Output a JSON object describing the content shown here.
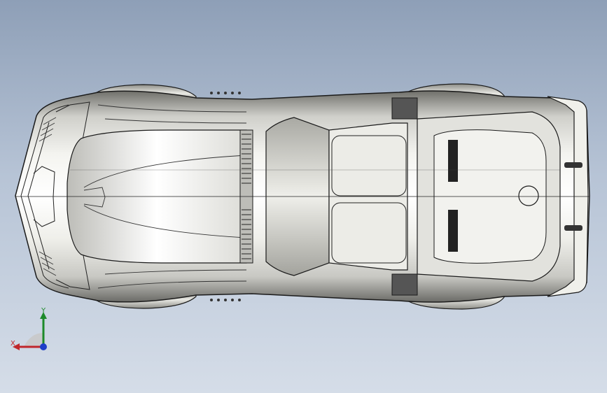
{
  "viewport": {
    "background_top": "#8e9fb7",
    "background_bottom": "#d5dde8"
  },
  "model": {
    "name": "car-body-top-view",
    "body_color": "#d9d9d4",
    "edge_color": "#1a1a1a"
  },
  "triad": {
    "x_label": "X",
    "y_label": "Y",
    "x_color": "#c0262b",
    "y_color": "#1d8a2a",
    "z_color": "#1f3fc8"
  }
}
